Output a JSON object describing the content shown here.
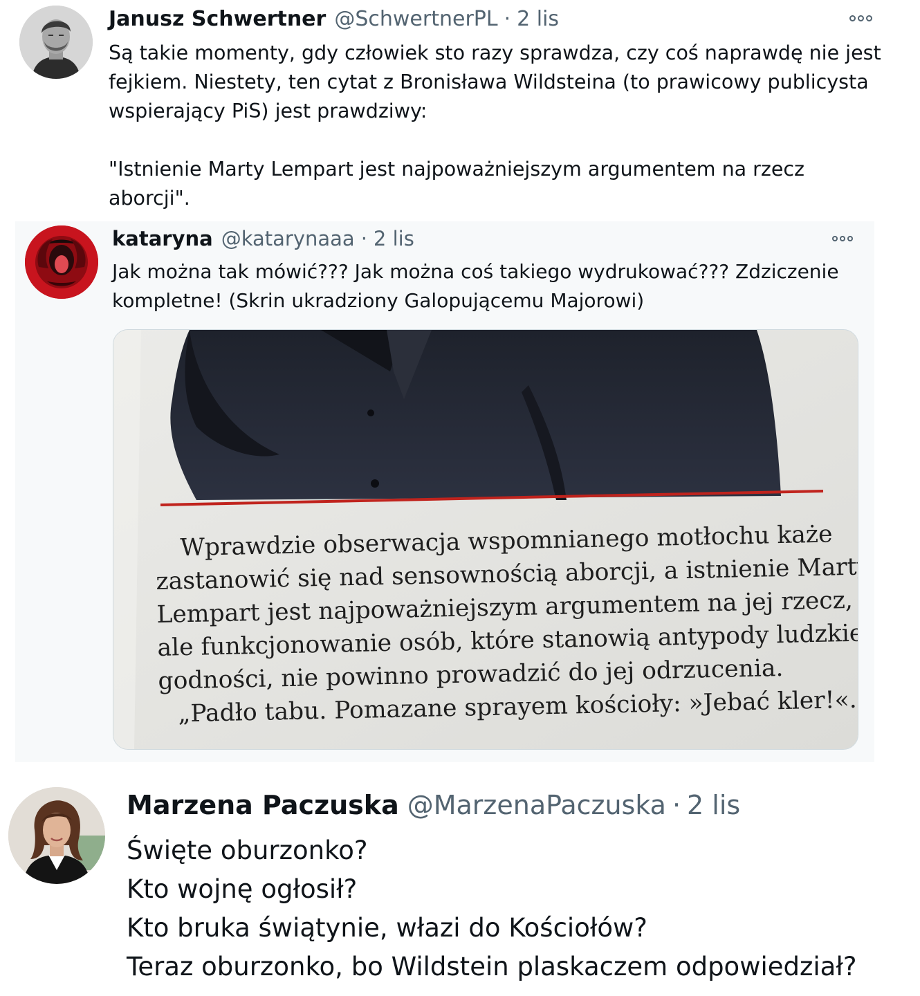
{
  "tweet1": {
    "name": "Janusz Schwertner",
    "handle": "@SchwertnerPL",
    "separator": "·",
    "time": "2 lis",
    "lines": [
      "Są takie momenty, gdy człowiek sto razy sprawdza, czy coś naprawdę nie jest",
      "fejkiem. Niestety, ten cytat z Bronisława Wildsteina (to prawicowy publicysta",
      "wspierający PiS) jest prawdziwy:"
    ],
    "quote_lines": [
      "\"Istnienie Marty Lempart jest najpoważniejszym argumentem na rzecz",
      "aborcji\"."
    ]
  },
  "quoted": {
    "name": "kataryna",
    "handle": "@katarynaaa",
    "separator": "·",
    "time": "2 lis",
    "lines": [
      "Jak można tak mówić??? Jak można coś takiego wydrukować??? Zdziczenie",
      "kompletne! (Skrin ukradziony Galopującemu Majorowi)"
    ],
    "image_text": [
      "Wprawdzie obserwacja wspomnianego motłochu każe",
      "zastanowić się nad sensownością aborcji, a istnienie Marty",
      "Lempart jest najpoważniejszym argumentem na jej rzecz,",
      "ale funkcjonowanie osób, które stanowią antypody ludzkiej",
      "godności, nie powinno prowadzić do jej odrzucenia.",
      "„Padło tabu. Pomazane sprayem kościoły: »Jebać kler!«."
    ]
  },
  "tweet3": {
    "name": "Marzena Paczuska",
    "handle": "@MarzenaPaczuska",
    "separator": "·",
    "time": "2 lis",
    "lines": [
      "Święte oburzonko?",
      "Kto wojnę ogłosił?",
      "Kto bruka świątynie, włazi do Kościołów?",
      "Teraz oburzonko, bo Wildstein plaskaczem odpowiedział?"
    ]
  },
  "icons": {
    "more": "more-horizontal-icon"
  },
  "colors": {
    "text": "#0f1419",
    "secondary": "#536471",
    "quote_bg": "#f7f9fa",
    "magazine_rule": "#c0231d"
  }
}
